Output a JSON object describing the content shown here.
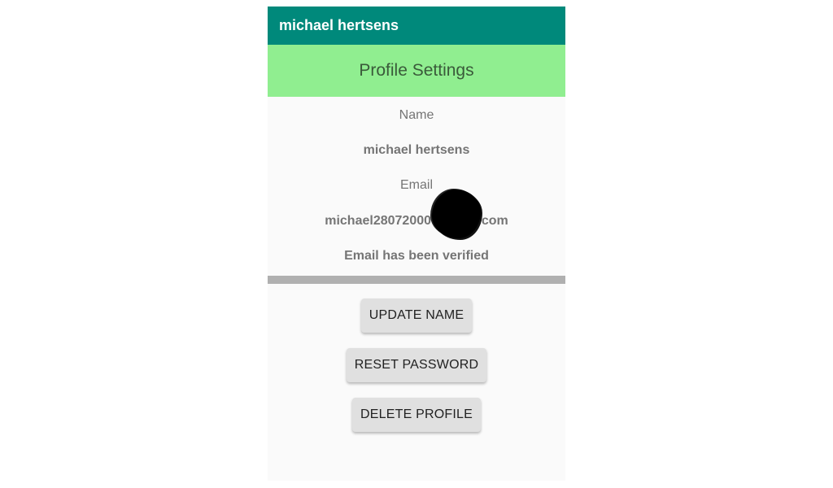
{
  "app_bar": {
    "title": "michael hertsens"
  },
  "header": {
    "title": "Profile Settings"
  },
  "profile": {
    "name_label": "Name",
    "name_value": "michael hertsens",
    "email_label": "Email",
    "email_value": "michael28072000@gmail.com",
    "verification_status": "Email has been verified"
  },
  "actions": {
    "update_name": "UPDATE NAME",
    "reset_password": "RESET PASSWORD",
    "delete_profile": "DELETE PROFILE"
  },
  "colors": {
    "app_bar": "#00897b",
    "header_banner": "#90ee90",
    "divider": "#b0b0b0",
    "button_bg": "#e0e0e0"
  }
}
